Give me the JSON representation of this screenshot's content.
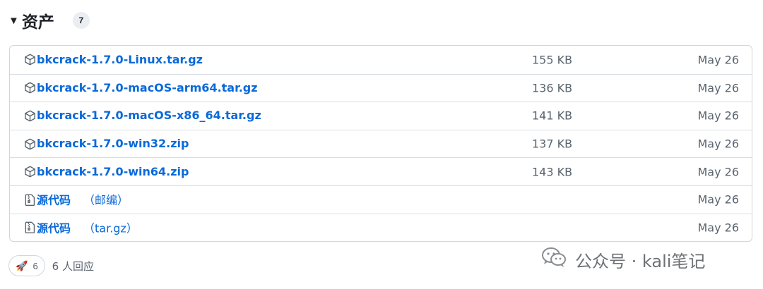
{
  "assets": {
    "title": "资产",
    "count": "7",
    "items": [
      {
        "icon": "package-icon",
        "name": "bkcrack-1.7.0-Linux.tar.gz",
        "suffix": "",
        "size": "155 KB",
        "date": "May 26"
      },
      {
        "icon": "package-icon",
        "name": "bkcrack-1.7.0-macOS-arm64.tar.gz",
        "suffix": "",
        "size": "136 KB",
        "date": "May 26"
      },
      {
        "icon": "package-icon",
        "name": "bkcrack-1.7.0-macOS-x86_64.tar.gz",
        "suffix": "",
        "size": "141 KB",
        "date": "May 26"
      },
      {
        "icon": "package-icon",
        "name": "bkcrack-1.7.0-win32.zip",
        "suffix": "",
        "size": "137 KB",
        "date": "May 26"
      },
      {
        "icon": "package-icon",
        "name": "bkcrack-1.7.0-win64.zip",
        "suffix": "",
        "size": "143 KB",
        "date": "May 26"
      },
      {
        "icon": "file-zip-icon",
        "name": "源代码",
        "suffix": "（邮编）",
        "size": "",
        "date": "May 26"
      },
      {
        "icon": "file-zip-icon",
        "name": "源代码",
        "suffix": "（tar.gz）",
        "size": "",
        "date": "May 26"
      }
    ]
  },
  "reactions": {
    "rocket_emoji": "🚀",
    "rocket_count": "6",
    "summary": "6 人回应"
  },
  "watermark": {
    "text": "公众号 · kali笔记"
  },
  "colors": {
    "link": "#0969da",
    "muted": "#59636e",
    "border": "#d0d7de"
  }
}
